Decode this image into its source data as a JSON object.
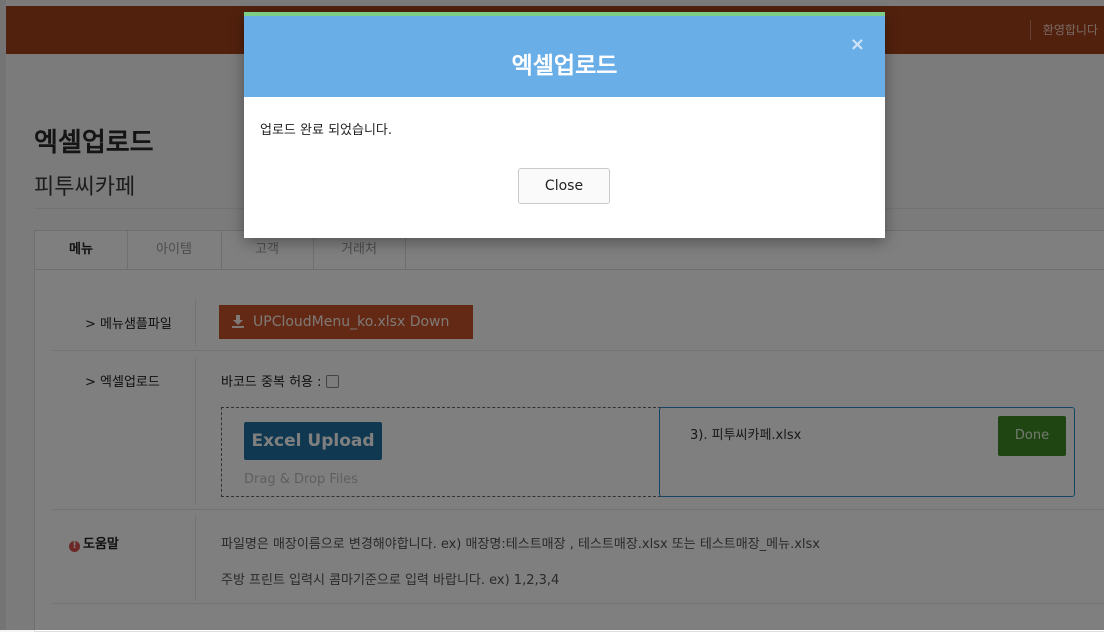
{
  "topbar": {
    "welcome_text": "환영합니다"
  },
  "page": {
    "title": "엑셀업로드",
    "subtitle": "피투씨카페"
  },
  "tabs": [
    {
      "label": "메뉴",
      "active": true
    },
    {
      "label": "아이템",
      "active": false
    },
    {
      "label": "고객",
      "active": false
    },
    {
      "label": "거래처",
      "active": false
    }
  ],
  "sample_row": {
    "label": "> 메뉴샘플파일",
    "download_label": "UPCloudMenu_ko.xlsx Down",
    "icon": "download-icon"
  },
  "upload_row": {
    "label": "> 엑셀업로드",
    "barcode_label": "바코드 중복 허용 :",
    "excel_upload_label": "Excel Upload",
    "drag_hint": "Drag & Drop Files",
    "file_name": "3). 피투씨카페.xlsx",
    "done_label": "Done"
  },
  "help": {
    "label": "도움말",
    "icon": "info-icon",
    "lines": [
      "파일명은 매장이름으로 변경해야합니다. ex) 매장명:테스트매장 , 테스트매장.xlsx 또는 테스트매장_메뉴.xlsx",
      "주방 프린트 입력시 콤마기준으로 입력 바랍니다. ex) 1,2,3,4"
    ]
  },
  "modal": {
    "title": "엑셀업로드",
    "message": "업로드 완료 되었습니다.",
    "close_label": "Close",
    "close_icon": "close-icon"
  },
  "colors": {
    "topbar": "#a4421a",
    "modal_header": "#6aaee8",
    "download_button": "#c8522b",
    "excel_button": "#2172a3",
    "done_button": "#3f8d24"
  }
}
